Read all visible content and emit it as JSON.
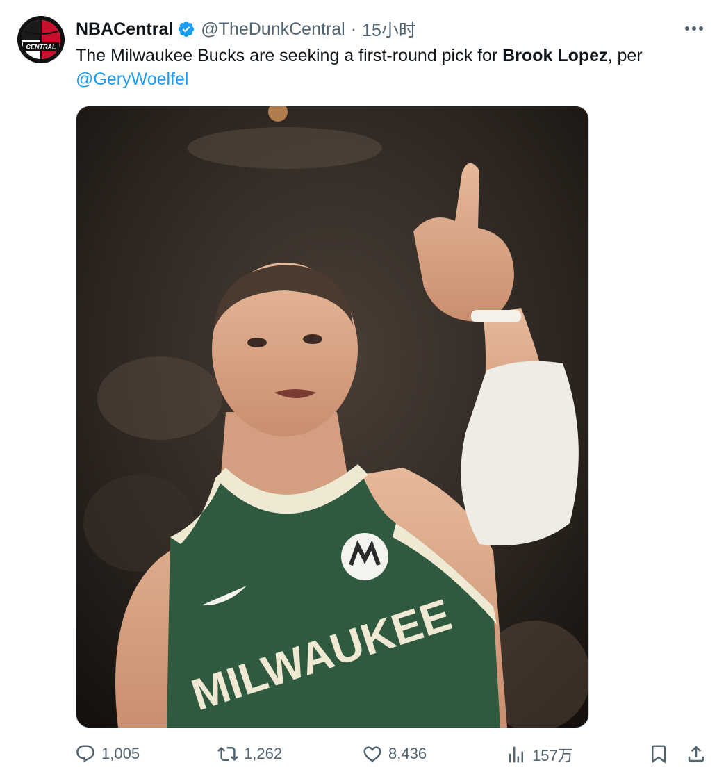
{
  "tweet": {
    "display_name": "NBACentral",
    "handle": "@TheDunkCentral",
    "separator": "·",
    "time": "15小时",
    "avatar_text": "CENTRAL",
    "text_part1": "The Milwaukee Bucks are seeking a first-round pick for ",
    "text_bold": "Brook Lopez",
    "text_part2": ", per",
    "mention": "@GeryWoelfel",
    "jersey_text": "MILWAUKEE"
  },
  "actions": {
    "replies": "1,005",
    "retweets": "1,262",
    "likes": "8,436",
    "views": "157万"
  },
  "icons": {
    "verified": "verified-badge-icon",
    "more": "more-icon",
    "reply": "reply-icon",
    "retweet": "retweet-icon",
    "like": "heart-icon",
    "views": "views-icon",
    "bookmark": "bookmark-icon",
    "share": "share-icon"
  },
  "colors": {
    "accent": "#1d9bf0",
    "text": "#0f1419",
    "muted": "#536471"
  }
}
